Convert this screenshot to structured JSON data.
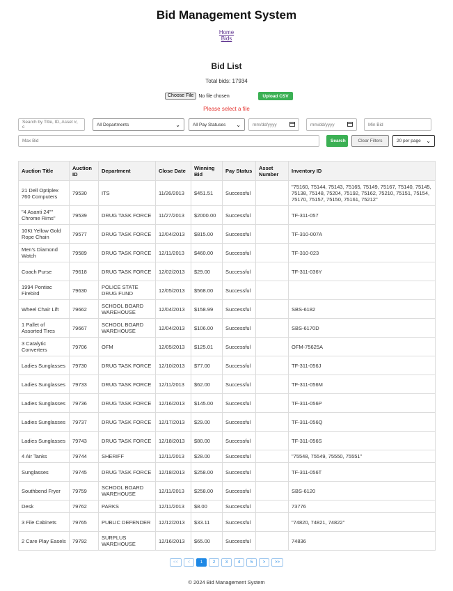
{
  "app_title": "Bid Management System",
  "nav": {
    "home": "Home",
    "bids": "Bids"
  },
  "section_title": "Bid List",
  "total_bids": "Total bids: 17934",
  "upload": {
    "choose_file_label": "Choose File",
    "file_status": "No file chosen",
    "upload_label": "Upload CSV",
    "error": "Please select a file"
  },
  "filters": {
    "search_placeholder": "Search by Title, ID, Asset #, c",
    "department": "All Departments",
    "pay_status": "All Pay Statuses",
    "date_from_placeholder": "mm/dd/yyyy",
    "date_to_placeholder": "mm/dd/yyyy",
    "min_bid_placeholder": "Min Bid",
    "max_bid_placeholder": "Max Bid",
    "search_label": "Search",
    "clear_label": "Clear Filters",
    "per_page": "20 per page"
  },
  "table": {
    "headers": [
      "Auction Title",
      "Auction ID",
      "Department",
      "Close Date",
      "Winning Bid",
      "Pay Status",
      "Asset Number",
      "Inventory ID"
    ],
    "rows": [
      [
        "21 Dell Optiplex 760 Computers",
        "79530",
        "ITS",
        "11/26/2013",
        "$451.51",
        "Successful",
        "",
        "\"75160, 75144, 75143, 75165, 75149, 75167, 75140, 75145, 75138, 75148, 75204, 75192, 75162, 75210, 75151, 75154, 75170, 75157, 75150, 75161, 75212\""
      ],
      [
        "\"4 Asanti 24\"\" Chrome Rims\"",
        "79539",
        "DRUG TASK FORCE",
        "11/27/2013",
        "$2000.00",
        "Successful",
        "",
        "TF-311-057"
      ],
      [
        "10Kt Yellow Gold Rope Chain",
        "79577",
        "DRUG TASK FORCE",
        "12/04/2013",
        "$815.00",
        "Successful",
        "",
        "TF-310-007A"
      ],
      [
        "Men's Diamond Watch",
        "79589",
        "DRUG TASK FORCE",
        "12/11/2013",
        "$460.00",
        "Successful",
        "",
        "TF-310-023"
      ],
      [
        "Coach Purse",
        "79618",
        "DRUG TASK FORCE",
        "12/02/2013",
        "$29.00",
        "Successful",
        "",
        "TF-311-036Y"
      ],
      [
        "1994 Pontiac Firebird",
        "79630",
        "POLICE STATE DRUG FUND",
        "12/05/2013",
        "$568.00",
        "Successful",
        "",
        ""
      ],
      [
        "Wheel Chair Lift",
        "79662",
        "SCHOOL BOARD WAREHOUSE",
        "12/04/2013",
        "$158.99",
        "Successful",
        "",
        "SBS-6182"
      ],
      [
        "1 Pallet of Assorted Tires",
        "79667",
        "SCHOOL BOARD WAREHOUSE",
        "12/04/2013",
        "$106.00",
        "Successful",
        "",
        "SBS-6170D"
      ],
      [
        "3 Catalytic Converters",
        "79706",
        "OFM",
        "12/05/2013",
        "$125.01",
        "Successful",
        "",
        "OFM-75625A"
      ],
      [
        "Ladies Sunglasses",
        "79730",
        "DRUG TASK FORCE",
        "12/10/2013",
        "$77.00",
        "Successful",
        "",
        "TF-311-056J"
      ],
      [
        "Ladies Sunglasses",
        "79733",
        "DRUG TASK FORCE",
        "12/11/2013",
        "$62.00",
        "Successful",
        "",
        "TF-311-056M"
      ],
      [
        "Ladies Sunglasses",
        "79736",
        "DRUG TASK FORCE",
        "12/16/2013",
        "$145.00",
        "Successful",
        "",
        "TF-311-056P"
      ],
      [
        "Ladies Sunglasses",
        "79737",
        "DRUG TASK FORCE",
        "12/17/2013",
        "$29.00",
        "Successful",
        "",
        "TF-311-056Q"
      ],
      [
        "Ladies Sunglasses",
        "79743",
        "DRUG TASK FORCE",
        "12/18/2013",
        "$80.00",
        "Successful",
        "",
        "TF-311-056S"
      ],
      [
        "4 Air Tanks",
        "79744",
        "SHERIFF",
        "12/11/2013",
        "$28.00",
        "Successful",
        "",
        "\"75548, 75549, 75550, 75551\""
      ],
      [
        "Sunglasses",
        "79745",
        "DRUG TASK FORCE",
        "12/18/2013",
        "$258.00",
        "Successful",
        "",
        "TF-311-056T"
      ],
      [
        "Southbend Fryer",
        "79759",
        "SCHOOL BOARD WAREHOUSE",
        "12/11/2013",
        "$258.00",
        "Successful",
        "",
        "SBS-6120"
      ],
      [
        "Desk",
        "79762",
        "PARKS",
        "12/11/2013",
        "$8.00",
        "Successful",
        "",
        "73776"
      ],
      [
        "3 File Cabinets",
        "79765",
        "PUBLIC DEFENDER",
        "12/12/2013",
        "$33.11",
        "Successful",
        "",
        "\"74820, 74821, 74822\""
      ],
      [
        "2 Care Play Easels",
        "79792",
        "SURPLUS WAREHOUSE",
        "12/16/2013",
        "$65.00",
        "Successful",
        "",
        "74836"
      ]
    ]
  },
  "pagination": {
    "first": "<<",
    "prev": "<",
    "pages": [
      "1",
      "2",
      "3",
      "4",
      "5"
    ],
    "next": ">",
    "last": ">>",
    "current": "1"
  },
  "footer": "© 2024 Bid Management System",
  "colors": {
    "accent_green": "#3bb054",
    "error_red": "#e53935",
    "link_purple": "#5a2d8c",
    "page_blue": "#1e88e5"
  }
}
